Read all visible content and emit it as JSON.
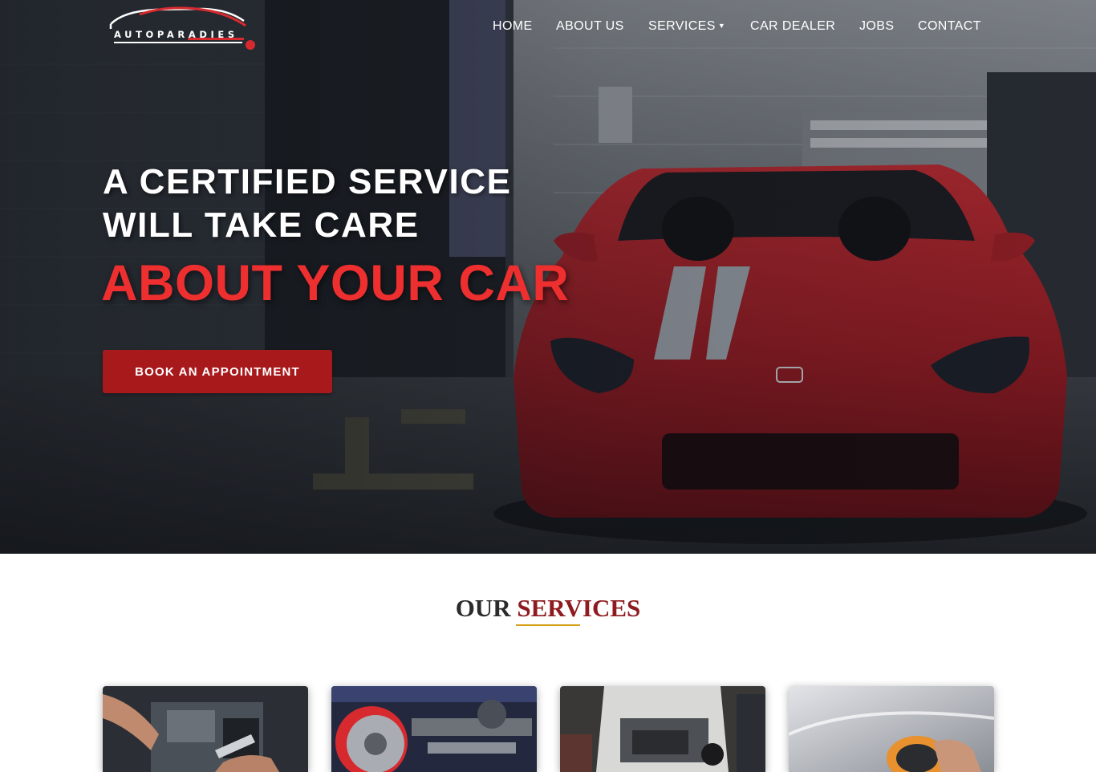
{
  "brand": {
    "name": "AUTOPARADIES",
    "logo_alt": "AutoParadies logo"
  },
  "nav": {
    "items": [
      {
        "label": "HOME"
      },
      {
        "label": "ABOUT US"
      },
      {
        "label": "SERVICES",
        "has_dropdown": true
      },
      {
        "label": "CAR DEALER"
      },
      {
        "label": "JOBS"
      },
      {
        "label": "CONTACT"
      }
    ],
    "dropdown_icon": "chevron-down-icon"
  },
  "hero": {
    "line1": "A CERTIFIED SERVICE",
    "line2": "WILL TAKE CARE",
    "accent": "ABOUT YOUR CAR",
    "cta_label": "BOOK AN APPOINTMENT",
    "image": "red sports car in a workshop garage"
  },
  "services": {
    "title_part1": "OUR",
    "title_part2": "SERVICES",
    "cards": [
      {
        "image": "mechanic hands with wrench over engine"
      },
      {
        "image": "brake disc and suspension assembly"
      },
      {
        "image": "car engine bay being repaired"
      },
      {
        "image": "polishing machine on car paint"
      }
    ]
  },
  "colors": {
    "accent_red": "#ee2f2f",
    "button_red": "#a8191c",
    "title_red": "#8e1b1f",
    "title_rule_gold": "#d4a017",
    "nav_text": "#ffffff"
  }
}
